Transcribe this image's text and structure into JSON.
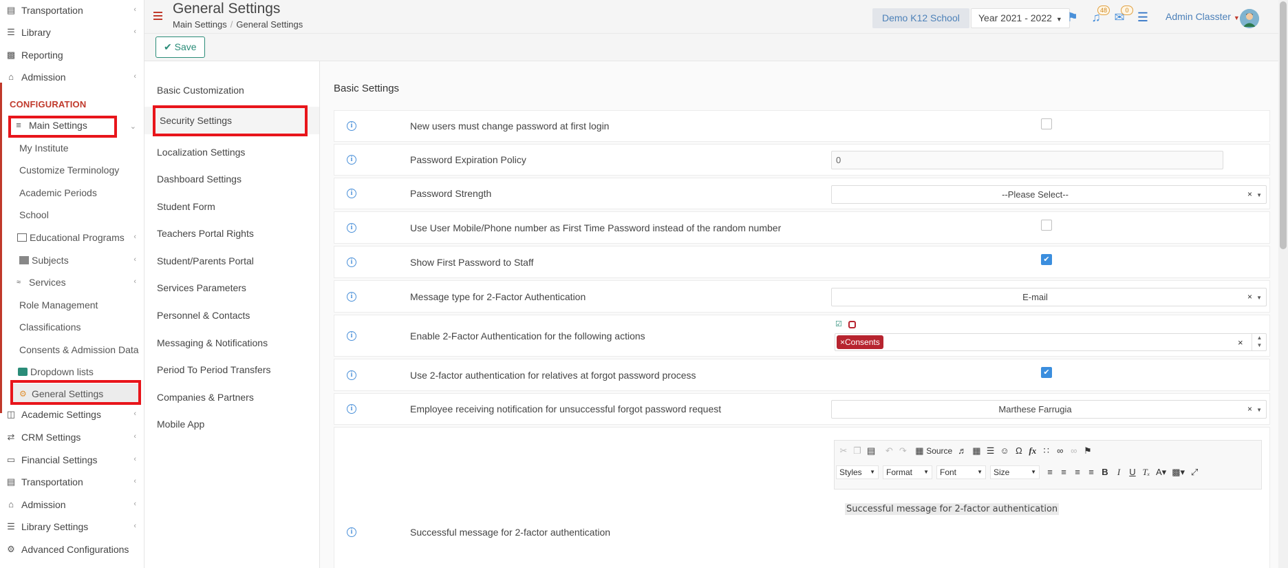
{
  "sidebar": {
    "top_items": [
      {
        "label": "Transportation",
        "icon": "bus-icon"
      },
      {
        "label": "Library",
        "icon": "books-icon"
      },
      {
        "label": "Reporting",
        "icon": "printer-icon"
      },
      {
        "label": "Admission",
        "icon": "institution-icon"
      }
    ],
    "section_label": "CONFIGURATION",
    "main_settings": "Main Settings",
    "sub_items": [
      "My Institute",
      "Customize Terminology",
      "Academic Periods",
      "School",
      "Educational Programs",
      "Subjects",
      "Services",
      "Role Management",
      "Classifications",
      "Consents & Admission Data",
      "Dropdown lists",
      "General Settings"
    ],
    "bottom_items": [
      {
        "label": "Academic Settings",
        "icon": "sitemap-icon"
      },
      {
        "label": "CRM Settings",
        "icon": "shuffle-icon"
      },
      {
        "label": "Financial Settings",
        "icon": "money-icon"
      },
      {
        "label": "Transportation",
        "icon": "bus-icon"
      },
      {
        "label": "Admission",
        "icon": "institution-icon"
      },
      {
        "label": "Library Settings",
        "icon": "books-icon"
      },
      {
        "label": "Advanced Configurations",
        "icon": "cogs-icon"
      }
    ]
  },
  "header": {
    "title": "General Settings",
    "breadcrumb": [
      "Main Settings",
      "General Settings"
    ],
    "school": "Demo K12 School",
    "year": "Year 2021 - 2022",
    "notifications_count": "48",
    "messages_count": "0",
    "user": "Admin Classter"
  },
  "toolbar": {
    "save_label": "Save"
  },
  "subnav": [
    "Basic Customization",
    "Security Settings",
    "Localization Settings",
    "Dashboard Settings",
    "Student Form",
    "Teachers Portal Rights",
    "Student/Parents Portal",
    "Services Parameters",
    "Personnel & Contacts",
    "Messaging & Notifications",
    "Period To Period Transfers",
    "Companies & Partners",
    "Mobile App"
  ],
  "content": {
    "section_title": "Basic Settings",
    "rows": [
      {
        "label": "New users must change password at first login",
        "checked": false
      },
      {
        "label": "Password Expiration Policy",
        "value": "0"
      },
      {
        "label": "Password Strength",
        "value": "--Please Select--"
      },
      {
        "label": "Use User Mobile/Phone number as First Time Password instead of the random number",
        "checked": false
      },
      {
        "label": "Show First Password to Staff",
        "checked": true
      },
      {
        "label": "Message type for 2-Factor Authentication",
        "value": "E-mail"
      },
      {
        "label": "Enable 2-Factor Authentication for the following actions",
        "tag": "Consents"
      },
      {
        "label": "Use 2-factor authentication for relatives at forgot password process",
        "checked": true
      },
      {
        "label": "Employee receiving notification for unsuccessful forgot password request",
        "value": "Marthese Farrugia"
      },
      {
        "label": "Successful message for 2-factor authentication"
      }
    ],
    "editor": {
      "source_label": "Source",
      "styles": "Styles",
      "format": "Format",
      "font": "Font",
      "size": "Size",
      "text": "Successful message for 2-factor authentication"
    }
  },
  "colors": {
    "accent_red": "#c0392b",
    "highlight_red": "#e8151b",
    "link_blue": "#4a90d9",
    "save_green": "#2a8c78",
    "tag_red": "#b7242f"
  }
}
